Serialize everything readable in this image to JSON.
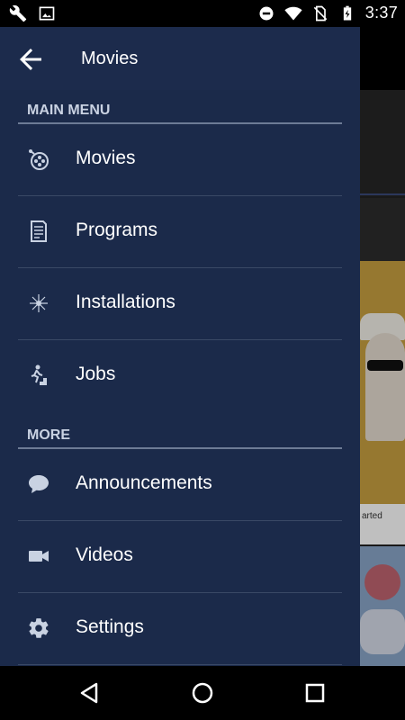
{
  "status_bar": {
    "time": "3:37",
    "icons": [
      "wrench-icon",
      "image-icon",
      "do-not-disturb-icon",
      "wifi-icon",
      "no-sim-icon",
      "battery-charging-icon"
    ]
  },
  "drawer": {
    "header_title": "Movies",
    "sections": [
      {
        "title": "MAIN MENU",
        "items": [
          {
            "label": "Movies",
            "icon": "film-reel-icon"
          },
          {
            "label": "Programs",
            "icon": "document-icon"
          },
          {
            "label": "Installations",
            "icon": "sparkle-icon"
          },
          {
            "label": "Jobs",
            "icon": "person-climbing-stairs-icon"
          }
        ]
      },
      {
        "title": "MORE",
        "items": [
          {
            "label": "Announcements",
            "icon": "speech-bubble-icon"
          },
          {
            "label": "Videos",
            "icon": "video-camera-icon"
          },
          {
            "label": "Settings",
            "icon": "gear-icon"
          }
        ]
      }
    ]
  },
  "background": {
    "caption": "arted"
  },
  "colors": {
    "drawer_bg": "#1b2a4a",
    "divider": "#3a4966",
    "section_rule": "#6d7b95",
    "text": "#ffffff"
  }
}
